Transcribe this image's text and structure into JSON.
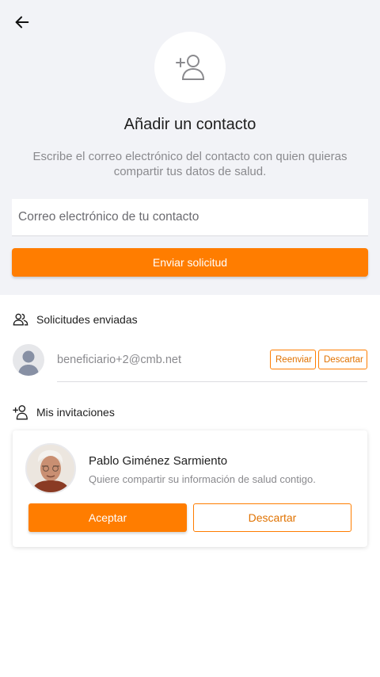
{
  "header": {
    "back_icon": "arrow-left-icon",
    "hero_icon": "add-user-icon",
    "title": "Añadir un contacto",
    "description": "Escribe el correo electrónico del contacto con quien quieras compartir tus datos de salud."
  },
  "form": {
    "email_placeholder": "Correo electrónico de tu contacto",
    "email_value": "",
    "submit_label": "Enviar solicitud"
  },
  "sent_requests": {
    "icon": "users-icon",
    "title": "Solicitudes enviadas",
    "items": [
      {
        "email": "beneficiario+2@cmb.net",
        "resend_label": "Reenviar",
        "discard_label": "Descartar"
      }
    ]
  },
  "invitations": {
    "icon": "add-user-icon",
    "title": "Mis invitaciones",
    "items": [
      {
        "name": "Pablo Giménez Sarmiento",
        "message": "Quiere compartir su información de salud contigo.",
        "accept_label": "Aceptar",
        "discard_label": "Descartar"
      }
    ]
  },
  "colors": {
    "accent": "#ff7d00",
    "background_top": "#f2f3f7",
    "muted_text": "#8a8a8e"
  }
}
